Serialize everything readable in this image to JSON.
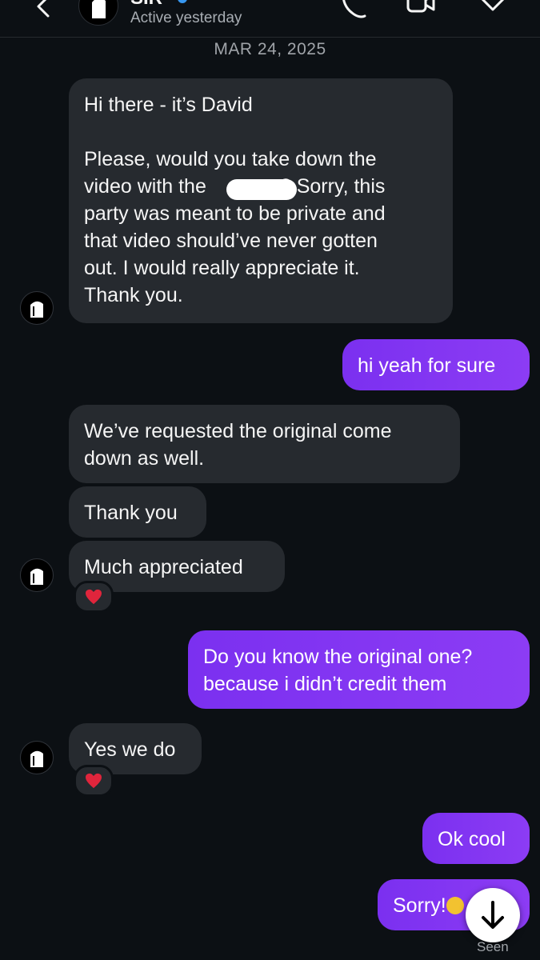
{
  "header": {
    "name": "SIR",
    "status": "Active yesterday",
    "icons": [
      "back-icon",
      "phone-icon",
      "video-icon",
      "tag-icon"
    ]
  },
  "date_divider": "MAR 24, 2025",
  "messages": [
    {
      "from": "them",
      "lines": [
        "Hi there - it’s David",
        "",
        "Please, would you take down the",
        "video with the",
        "party was meant to be private and",
        "that video should’ve never gotten",
        "out. I would really appreciate it.",
        "Thank you."
      ],
      "redacted_tail": "? Sorry, this"
    },
    {
      "from": "me",
      "text": "hi yeah for sure"
    },
    {
      "from": "them",
      "lines": [
        "We’ve requested the original come",
        "down as well."
      ]
    },
    {
      "from": "them",
      "text": "Thank you"
    },
    {
      "from": "them",
      "text": "Much appreciated",
      "reaction": "heart"
    },
    {
      "from": "me",
      "lines": [
        "Do you know the original one?",
        "because i didn’t credit them"
      ]
    },
    {
      "from": "them",
      "text": "Yes we do",
      "reaction": "heart"
    },
    {
      "from": "me",
      "text": "Ok cool"
    },
    {
      "from": "me",
      "text": "Sorry!"
    }
  ],
  "seen_label": "Seen",
  "colors": {
    "background": "#0c1014",
    "incoming": "#262a2f",
    "outgoing": "#8239f2",
    "reaction": "#e0253c"
  }
}
